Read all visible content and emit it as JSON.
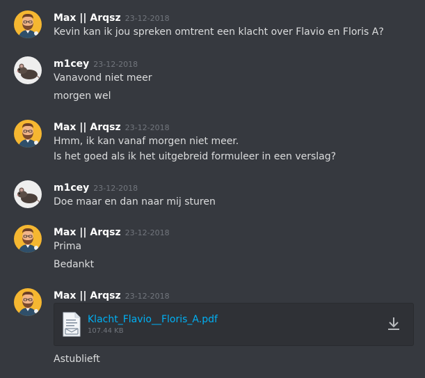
{
  "colors": {
    "background": "#36393f",
    "username": "#ffffff",
    "message_text": "#dcddde",
    "timestamp": "#72767d",
    "link": "#00b0f4",
    "attachment_bg": "#2f3136"
  },
  "messages": [
    {
      "author": "Max || Arqsz",
      "avatar_icon": "bearded-man-avatar-icon",
      "timestamp": "23-12-2018",
      "lines": [
        "Kevin kan ik jou spreken omtrent een klacht over Flavio en Floris A?"
      ]
    },
    {
      "author": "m1cey",
      "avatar_icon": "rat-avatar-icon",
      "timestamp": "23-12-2018",
      "lines": [
        "Vanavond niet meer",
        "morgen wel"
      ]
    },
    {
      "author": "Max || Arqsz",
      "avatar_icon": "bearded-man-avatar-icon",
      "timestamp": "23-12-2018",
      "lines": [
        "Hmm, ik kan vanaf morgen niet meer.",
        "Is het goed als ik het uitgebreid formuleer in een verslag?"
      ]
    },
    {
      "author": "m1cey",
      "avatar_icon": "rat-avatar-icon",
      "timestamp": "23-12-2018",
      "lines": [
        "Doe maar en dan naar mij sturen"
      ]
    },
    {
      "author": "Max || Arqsz",
      "avatar_icon": "bearded-man-avatar-icon",
      "timestamp": "23-12-2018",
      "lines": [
        "Prima",
        "Bedankt"
      ]
    },
    {
      "author": "Max || Arqsz",
      "avatar_icon": "bearded-man-avatar-icon",
      "timestamp": "23-12-2018",
      "lines": [
        "Astublieft"
      ],
      "attachment": {
        "file_name": "Klacht_Flavio__Floris_A.pdf",
        "file_size": "107.44 KB",
        "file_icon": "document-file-icon",
        "download_icon": "download-icon"
      }
    }
  ]
}
